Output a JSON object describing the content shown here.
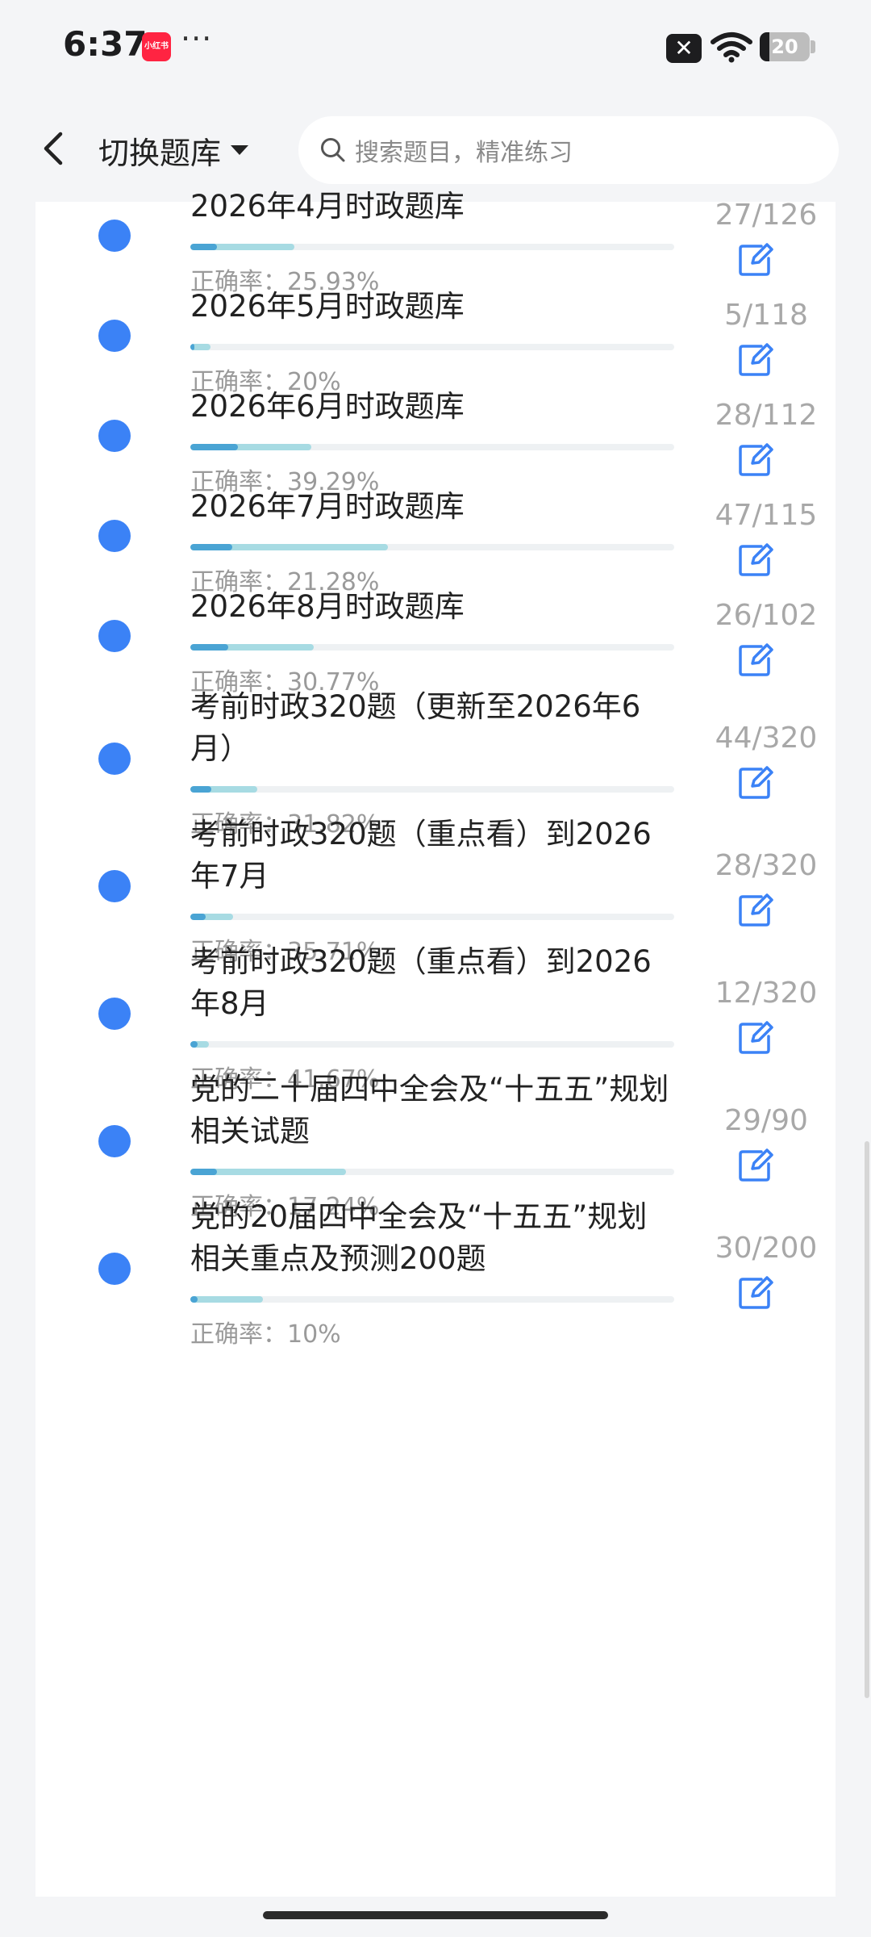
{
  "status": {
    "time": "6:37",
    "app_badge": "小红书",
    "more": "···",
    "battery": "20",
    "battery_level": 0.2
  },
  "header": {
    "switch_label": "切换题库",
    "search_placeholder": "搜索题目，精准练习"
  },
  "items": [
    {
      "title": "2026年4月时政题库",
      "rate": "正确率：25.93%",
      "count": "27/126",
      "progress": 0.2143,
      "accuracy": 0.2593
    },
    {
      "title": "2026年5月时政题库",
      "rate": "正确率：20%",
      "count": "5/118",
      "progress": 0.0424,
      "accuracy": 0.2
    },
    {
      "title": "2026年6月时政题库",
      "rate": "正确率：39.29%",
      "count": "28/112",
      "progress": 0.25,
      "accuracy": 0.3929
    },
    {
      "title": "2026年7月时政题库",
      "rate": "正确率：21.28%",
      "count": "47/115",
      "progress": 0.4087,
      "accuracy": 0.2128
    },
    {
      "title": "2026年8月时政题库",
      "rate": "正确率：30.77%",
      "count": "26/102",
      "progress": 0.2549,
      "accuracy": 0.3077
    },
    {
      "title": "考前时政320题（更新至2026年6月）",
      "rate": "正确率：31.82%",
      "count": "44/320",
      "progress": 0.1375,
      "accuracy": 0.3182
    },
    {
      "title": "考前时政320题（重点看）到2026年7月",
      "rate": "正确率：35.71%",
      "count": "28/320",
      "progress": 0.0875,
      "accuracy": 0.3571
    },
    {
      "title": "考前时政320题（重点看）到2026年8月",
      "rate": "正确率：41.67%",
      "count": "12/320",
      "progress": 0.0375,
      "accuracy": 0.4167
    },
    {
      "title": "党的二十届四中全会及“十五五”规划相关试题",
      "rate": "正确率：17.24%",
      "count": "29/90",
      "progress": 0.3222,
      "accuracy": 0.1724
    },
    {
      "title": "党的20届四中全会及“十五五”规划相关重点及预测200题",
      "rate": "正确率：10%",
      "count": "30/200",
      "progress": 0.15,
      "accuracy": 0.1
    }
  ]
}
